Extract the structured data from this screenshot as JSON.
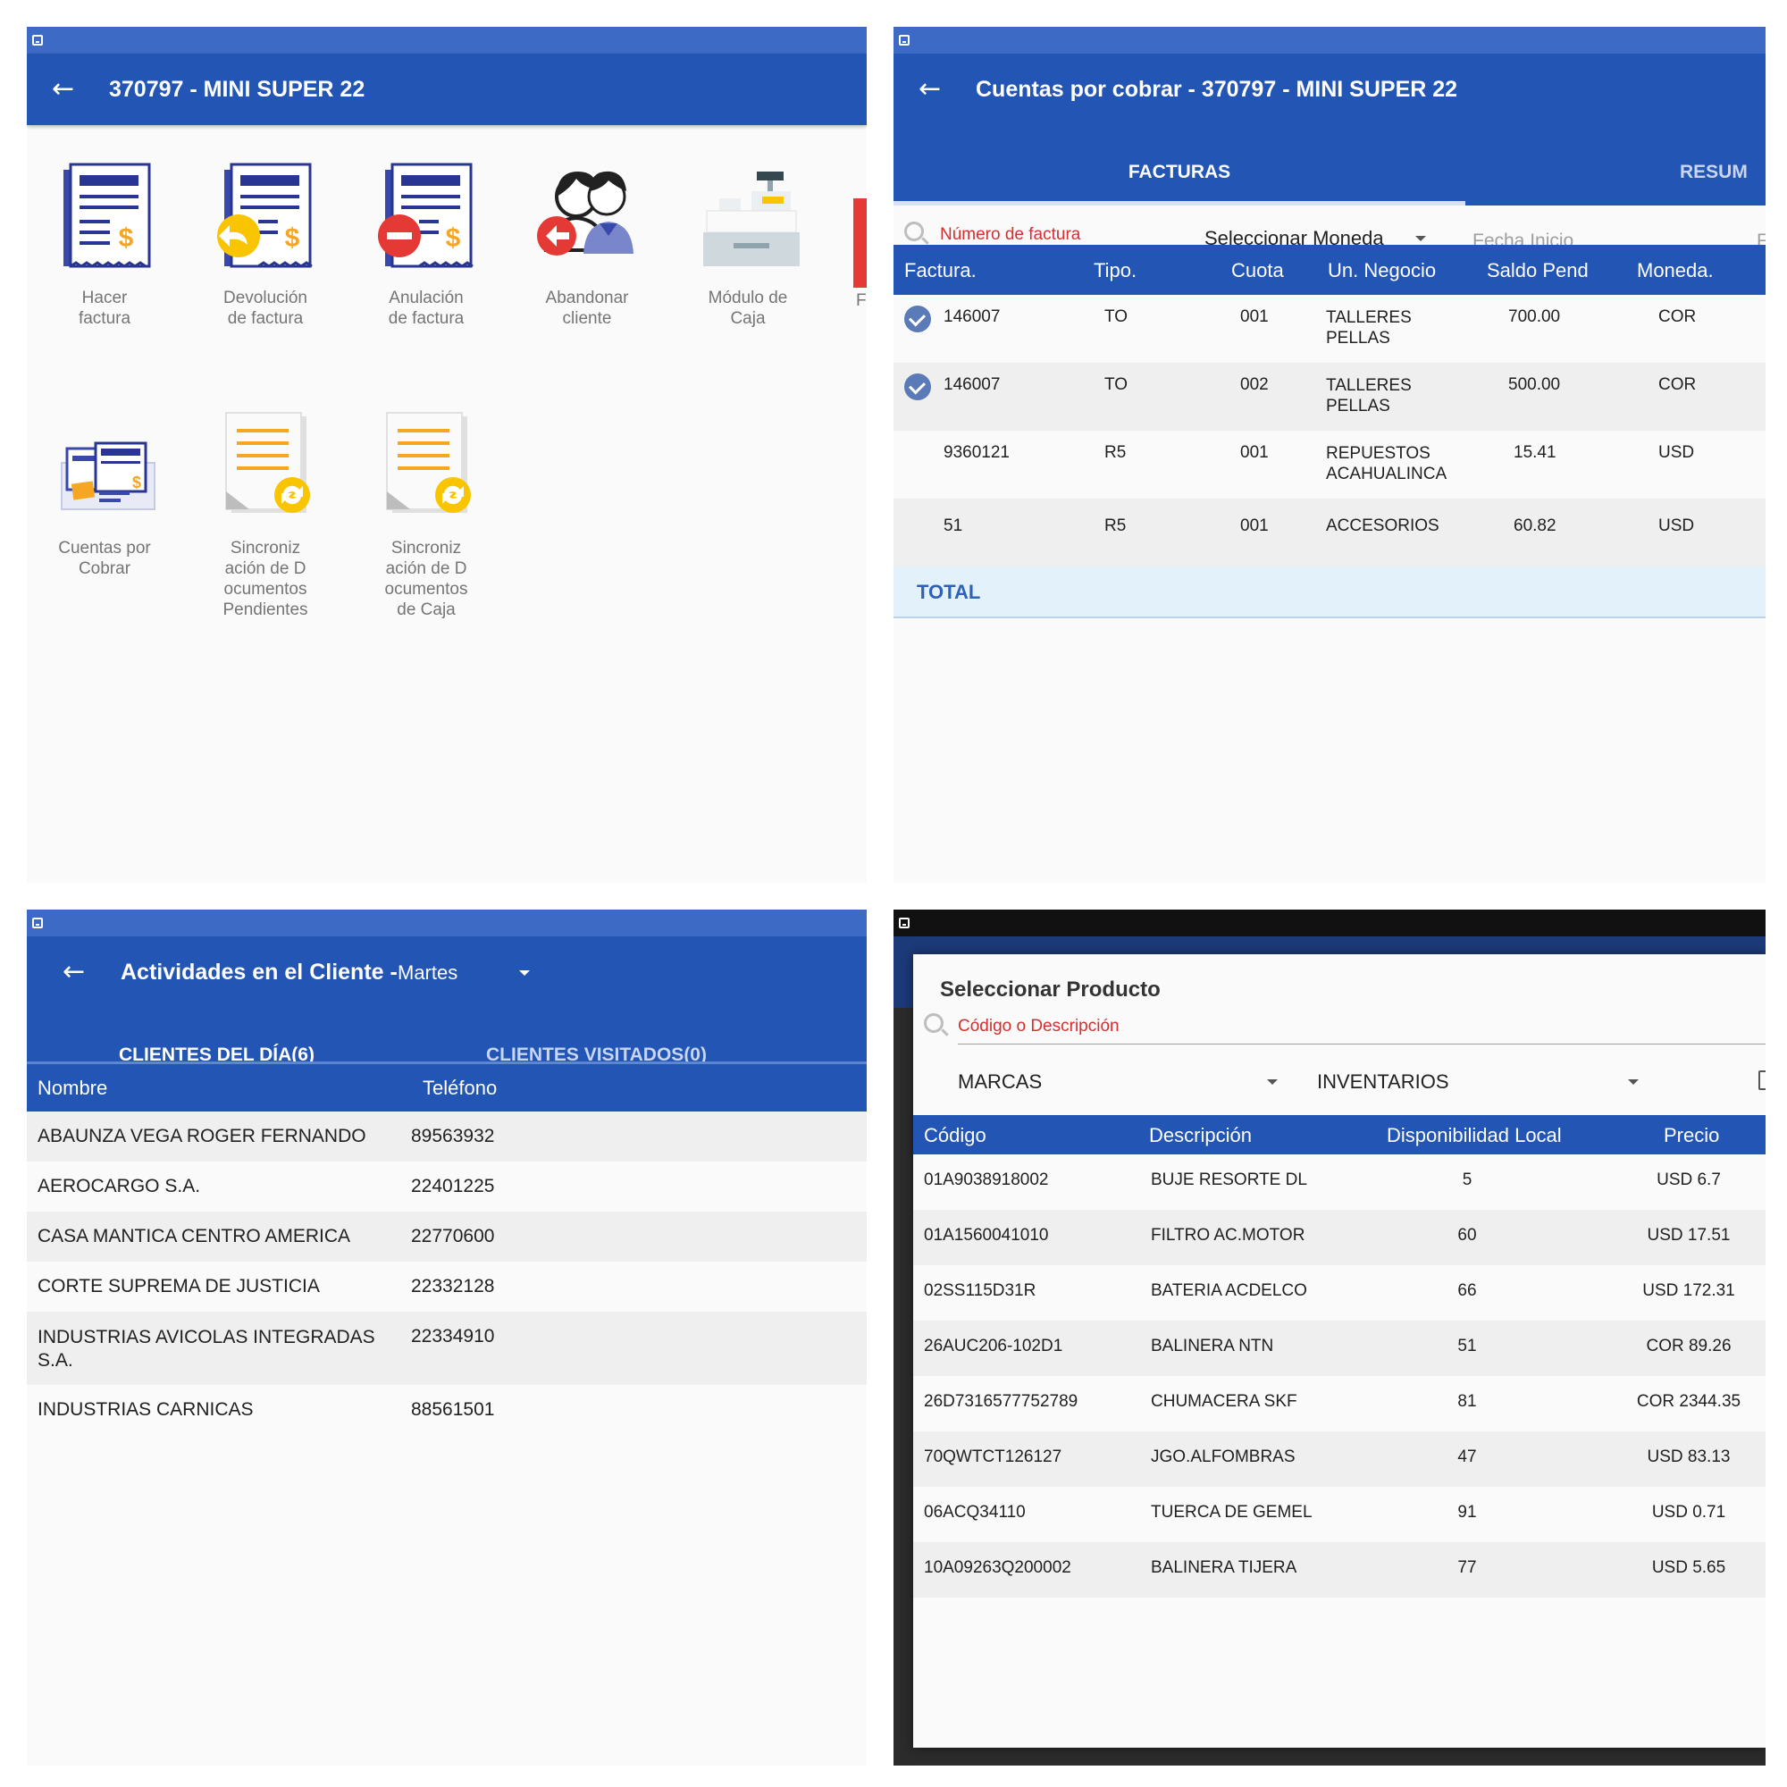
{
  "panel1": {
    "title": "370797 - MINI SUPER 22",
    "tiles": [
      {
        "label": "Hacer\nfactura",
        "icon": "invoice-icon"
      },
      {
        "label": "Devolución\nde factura",
        "icon": "invoice-return-icon"
      },
      {
        "label": "Anulación\nde factura",
        "icon": "invoice-cancel-icon"
      },
      {
        "label": "Abandonar\ncliente",
        "icon": "leave-client-icon"
      },
      {
        "label": "Módulo de\nCaja",
        "icon": "cash-register-icon"
      },
      {
        "label": "Cuentas por\nCobrar",
        "icon": "accounts-receivable-icon"
      },
      {
        "label": "Sincroniz\nación de D\nocumentos\nPendientes",
        "icon": "sync-documents-icon"
      },
      {
        "label": "Sincroniz\nación de D\nocumentos\nde Caja",
        "icon": "sync-cash-documents-icon"
      }
    ],
    "partial_tile_label": "F"
  },
  "panel2": {
    "title": "Cuentas por cobrar - 370797 - MINI SUPER 22",
    "tabs": [
      "FACTURAS",
      "RESUM"
    ],
    "search_placeholder": "Número de factura",
    "currency_select": "Seleccionar Moneda",
    "date_start_placeholder": "Fecha Inicio",
    "date_end_partial": "F",
    "columns": [
      "Factura.",
      "Tipo.",
      "Cuota",
      "Un. Negocio",
      "Saldo Pend",
      "Moneda."
    ],
    "rows": [
      {
        "checked": true,
        "factura": "146007",
        "tipo": "TO",
        "cuota": "001",
        "negocio": "TALLERES\nPELLAS",
        "saldo": "700.00",
        "moneda": "COR"
      },
      {
        "checked": true,
        "factura": "146007",
        "tipo": "TO",
        "cuota": "002",
        "negocio": "TALLERES\nPELLAS",
        "saldo": "500.00",
        "moneda": "COR"
      },
      {
        "checked": false,
        "factura": "9360121",
        "tipo": "R5",
        "cuota": "001",
        "negocio": "REPUESTOS\nACAHUALINCA",
        "saldo": "15.41",
        "moneda": "USD"
      },
      {
        "checked": false,
        "factura": "51",
        "tipo": "R5",
        "cuota": "001",
        "negocio": "ACCESORIOS",
        "saldo": "60.82",
        "moneda": "USD"
      }
    ],
    "total_label": "TOTAL"
  },
  "panel3": {
    "title": "Actividades en el Cliente -",
    "day_select": "Martes",
    "tabs": [
      "CLIENTES DEL DÍA(6)",
      "CLIENTES VISITADOS(0)"
    ],
    "columns": [
      "Nombre",
      "Teléfono"
    ],
    "rows": [
      {
        "nombre": "ABAUNZA VEGA ROGER FERNANDO",
        "telefono": "89563932"
      },
      {
        "nombre": "AEROCARGO S.A.",
        "telefono": "22401225"
      },
      {
        "nombre": "CASA MANTICA CENTRO AMERICA",
        "telefono": "22770600"
      },
      {
        "nombre": "CORTE SUPREMA DE JUSTICIA",
        "telefono": "22332128"
      },
      {
        "nombre": "INDUSTRIAS AVICOLAS INTEGRADAS\nS.A.",
        "telefono": "22334910"
      },
      {
        "nombre": "INDUSTRIAS CARNICAS",
        "telefono": "88561501"
      }
    ]
  },
  "panel4": {
    "dialog_title": "Seleccionar Producto",
    "search_placeholder": "Código o Descripción",
    "brand_select": "MARCAS",
    "inventory_select": "INVENTARIOS",
    "columns": [
      "Código",
      "Descripción",
      "Disponibilidad Local",
      "Precio"
    ],
    "rows": [
      {
        "codigo": "01A9038918002",
        "descripcion": "BUJE RESORTE DL",
        "disponibilidad": "5",
        "precio": "USD 6.7"
      },
      {
        "codigo": "01A1560041010",
        "descripcion": "FILTRO AC.MOTOR",
        "disponibilidad": "60",
        "precio": "USD 17.51"
      },
      {
        "codigo": "02SS115D31R",
        "descripcion": "BATERIA ACDELCO",
        "disponibilidad": "66",
        "precio": "USD 172.31"
      },
      {
        "codigo": "26AUC206-102D1",
        "descripcion": "BALINERA NTN",
        "disponibilidad": "51",
        "precio": "COR 89.26"
      },
      {
        "codigo": "26D7316577752789",
        "descripcion": "CHUMACERA SKF",
        "disponibilidad": "81",
        "precio": "COR 2344.35"
      },
      {
        "codigo": "70QWTCT126127",
        "descripcion": "JGO.ALFOMBRAS",
        "disponibilidad": "47",
        "precio": "USD 83.13"
      },
      {
        "codigo": "06ACQ34110",
        "descripcion": "TUERCA DE GEMEL",
        "disponibilidad": "91",
        "precio": "USD 0.71"
      },
      {
        "codigo": "10A09263Q200002",
        "descripcion": "BALINERA TIJERA",
        "disponibilidad": "77",
        "precio": "USD 5.65"
      }
    ]
  },
  "colors": {
    "primary": "#2355b4",
    "status_bar": "#3d6ac4",
    "accent_orange": "#f5a623",
    "error_red": "#d32f2f",
    "total_bg": "#e3f1fb"
  }
}
